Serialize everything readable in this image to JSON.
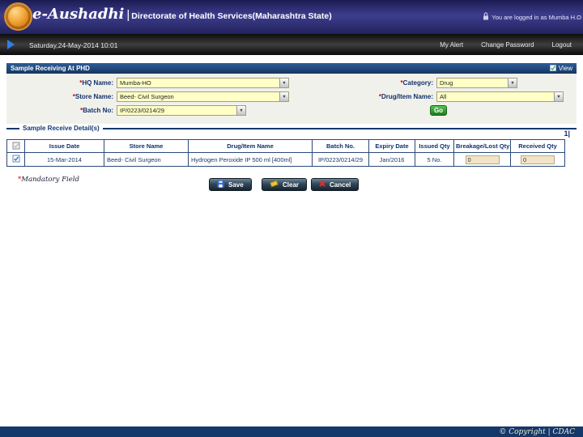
{
  "header": {
    "brand": "e-Aushadhi",
    "separator": "|",
    "org": "Directorate of Health Services(Maharashtra State)",
    "login_status": "You are logged in as Mumba H.O"
  },
  "navbar": {
    "datetime": "Saturday,24-May-2014 10:01",
    "links": [
      "My Alert",
      "Change Password",
      "Logout"
    ]
  },
  "page": {
    "title": "Sample Receiving At PHD",
    "view_label": "View",
    "page_indicator": "1|"
  },
  "form": {
    "star": "*",
    "fields": [
      {
        "label": "HQ Name:",
        "value": "Mumba-HO"
      },
      {
        "label": "Category:",
        "value": "Drug"
      },
      {
        "label": "Store Name:",
        "value": "Beed- Civil Surgeon"
      },
      {
        "label": "Drug/Item Name:",
        "value": "All"
      },
      {
        "label": "Batch No:",
        "value": "IP/0223/0214/29"
      }
    ],
    "go_label": "Go"
  },
  "details": {
    "section_title": "Sample Receive Detail(s)",
    "headers": [
      "Issue Date",
      "Store Name",
      "Drug/Item Name",
      "Batch No.",
      "Expiry Date",
      "Issued Qty",
      "Breakage/Lost Qty",
      "Received Qty"
    ],
    "row": {
      "issue_date": "15-Mar-2014",
      "store_name": "Beed- Civil Surgeon",
      "drug_item": "Hydrogen Peroxide IP 500 ml [400ml]",
      "batch_no": "IP/0223/0214/29",
      "expiry_date": "Jan/2016",
      "issued_qty": "5 No.",
      "breakage_qty": "0",
      "received_qty": "0"
    },
    "mandatory_note": "Mandatory Field"
  },
  "actions": {
    "save": "Save",
    "clear": "Clear",
    "cancel": "Cancel"
  },
  "footer": {
    "copyright": "© Copyright | CDAC"
  },
  "icons": {
    "dropdown": "▼"
  },
  "colors": {
    "header_blue": "#33337e",
    "title_strip_blue": "#1c3e6e",
    "input_yellow": "#ffffc6",
    "go_green": "#2e9e35",
    "footer_blue": "#15386a"
  }
}
